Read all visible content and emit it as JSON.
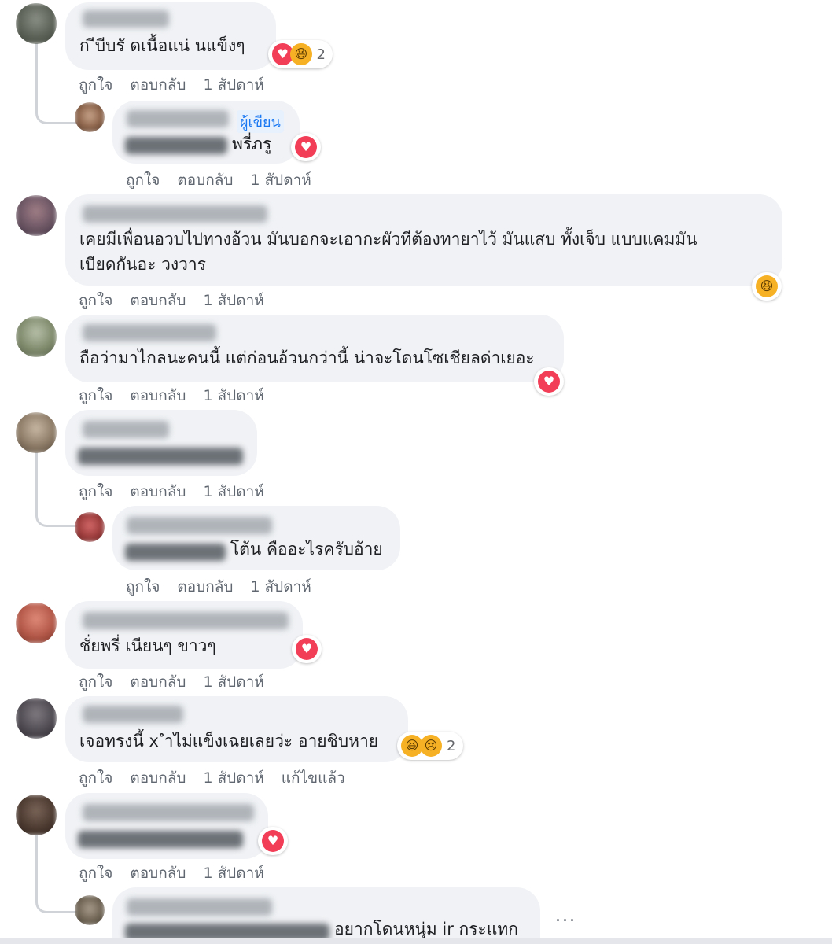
{
  "actions": {
    "like": "ถูกใจ",
    "reply": "ตอบกลับ",
    "time": "1 สัปดาห์",
    "edited": "แก้ไขแล้ว"
  },
  "c1": {
    "text": "ก ีบีบรั ดเนื้อแน่ นแข็งๆ",
    "reaction_count": "2"
  },
  "r1": {
    "badge": "ผู้เขียน",
    "text": "พรี่ภรู"
  },
  "c2": {
    "line1": "เคยมีเพื่อนอวบไปทางอ้วน มันบอกจะเอากะผัวทีต้องทายาไว้ มันแสบ ทั้งเจ็บ แบบแคมมัน",
    "line2": "เบียดกันอะ วงวาร"
  },
  "c3": {
    "text": "ถือว่ามาไกลนะคนนี้ แต่ก่อนอ้วนกว่านี้ น่าจะโดนโซเชียลด่าเยอะ"
  },
  "r4": {
    "text": "โต้น คืออะไรครับอ้าย"
  },
  "c5": {
    "text": "ชั่ยพรี่ เนียนๆ ขาวๆ"
  },
  "c6": {
    "text": "เจอทรงนี้ x ำไม่แข็งเฉยเลยว่ะ อายชิบหาย",
    "reaction_count": "2"
  },
  "r7": {
    "text": "อยากโดนหนุ่ม ir กระแทก"
  },
  "more": "...",
  "icons": {
    "heart": "heart-reaction-icon",
    "haha": "haha-reaction-icon",
    "sad": "sad-reaction-icon"
  },
  "colors": {
    "bubble": "#f0f2f5",
    "heart": "#f33e58",
    "haha": "#f7b125",
    "badge": "#1877f2"
  }
}
